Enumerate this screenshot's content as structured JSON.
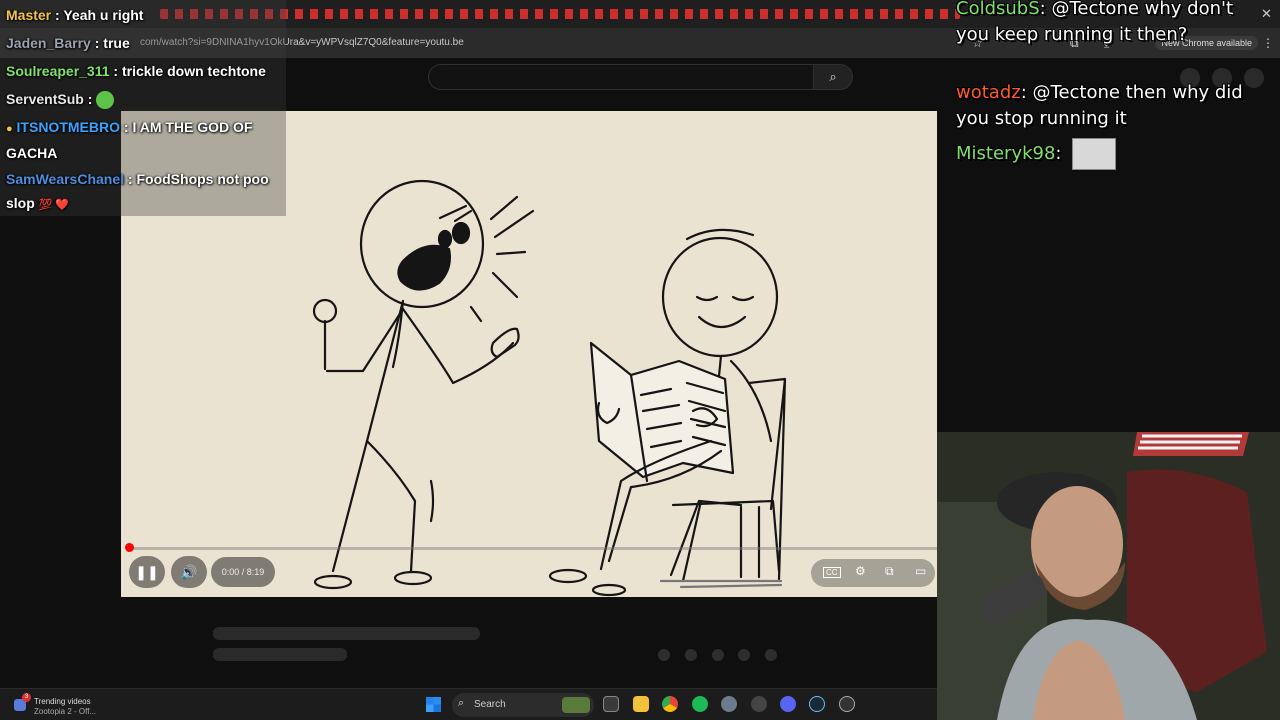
{
  "browser": {
    "url": "com/watch?si=9DNINA1hyv1OkUra&v=yWPVsqlZ7Q0&feature=youtu.be",
    "update_badge": "New Chrome available"
  },
  "icons": {
    "search": "search-icon",
    "pause": "pause-icon",
    "volume": "volume-icon",
    "captions": "captions-icon",
    "settings": "gear-icon",
    "miniplayer": "miniplayer-icon",
    "theater": "theater-icon"
  },
  "player": {
    "time": "0:00 / 8:19",
    "progress_fraction": 0.0,
    "cc_label": "CC"
  },
  "chat_left": [
    {
      "name": "Master",
      "sep": " : ",
      "text": "Yeah u right",
      "color": "#f5c542"
    },
    {
      "name": "Jaden_Barry",
      "sep": " : ",
      "text": "true",
      "color": "#9aa3ad"
    },
    {
      "name": "Soulreaper_311",
      "sep": " : ",
      "text": "trickle down techtone",
      "color": "#7ee26b"
    },
    {
      "name": "ServentSub",
      "sep": " : ",
      "text": "",
      "color": "#e8e8e8",
      "emote": "green-emote"
    },
    {
      "name": "ITSNOTMEBRO",
      "sep": " : ",
      "text": "I AM THE GOD OF GACHA",
      "color": "#3aa3ff",
      "badge": "bulb-badge"
    },
    {
      "name": "SamWearsChanel",
      "sep": " : ",
      "text": "FoodShops not poo slop",
      "color": "#4d8fe0",
      "tail": "💯 ❤️"
    }
  ],
  "chat_right": [
    {
      "name": "ColdsubS",
      "sep": ":",
      "text": "@Tectone why don't you keep running it then?",
      "color": "#7ee26b"
    },
    {
      "name": "wotadz",
      "sep": ":",
      "text": "@Tectone then why did you stop running it",
      "color": "#ff5a2a"
    },
    {
      "name": "Misteryk98",
      "sep": ":",
      "text": "",
      "color": "#7ee26b",
      "emote": "cat-emote"
    }
  ],
  "taskbar": {
    "widget_title": "Trending videos",
    "widget_sub": "Zootopia 2 - Off...",
    "widget_badge": "3",
    "search_label": "Search"
  },
  "colors": {
    "red": "#ff0000",
    "video_bg": "#ebe3d1",
    "page_bg": "#0f0f0f"
  }
}
